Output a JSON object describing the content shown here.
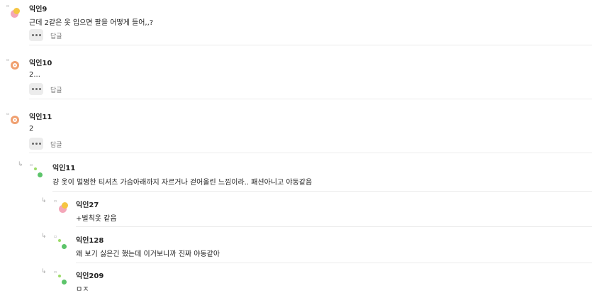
{
  "reply_label": "답글",
  "reply_arrow": "↳",
  "comments": [
    {
      "name": "익인9",
      "text": "근데 2같은 옷 입으면 팔을 어떻게 들어,,?",
      "avatar": "banana-avatar-icon"
    },
    {
      "name": "익인10",
      "text": "2...",
      "avatar": "orange-avatar-icon"
    },
    {
      "name": "익인11",
      "text": "2",
      "avatar": "orange-avatar-icon"
    }
  ],
  "replies": [
    {
      "name": "익인11",
      "text": "걍 옷이 멀쩡한 티셔츠 가슴아래까지 자르거나 걷어올린 느낌이라.. 패션아니고 야동같음",
      "avatar": "green-dots-avatar-icon"
    },
    {
      "name": "익인27",
      "text": "+벌칙옷 같음",
      "avatar": "banana-avatar-icon"
    },
    {
      "name": "익인128",
      "text": "왜 보기 싫은긴 했는데 이거보니까 진짜 야동같아",
      "avatar": "green-dots-avatar-icon"
    },
    {
      "name": "익인209",
      "text": "ㅁㅈ",
      "avatar": "green-dots-avatar-icon"
    }
  ],
  "colors": {
    "orange": "#f0a070",
    "orange_inner": "#ffffff",
    "yellow": "#f5c542",
    "pink": "#f4a7b9",
    "green": "#5cc46a",
    "light_green": "#9ddb6a"
  }
}
